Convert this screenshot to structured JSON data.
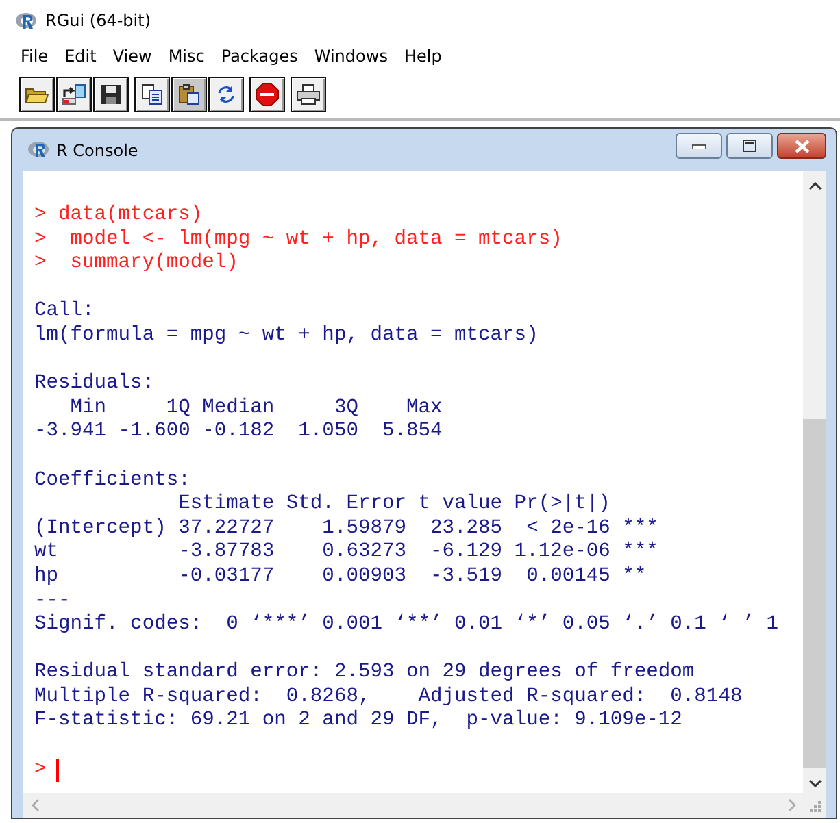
{
  "window": {
    "title": "RGui (64-bit)"
  },
  "menu": [
    "File",
    "Edit",
    "View",
    "Misc",
    "Packages",
    "Windows",
    "Help"
  ],
  "console": {
    "title": "R Console",
    "blocks": [
      {
        "lines": [
          {
            "kind": "input",
            "text": "> data(mtcars)"
          },
          {
            "kind": "input",
            "text": ">  model <- lm(mpg ~ wt + hp, data = mtcars)"
          },
          {
            "kind": "input",
            "text": ">  summary(model)"
          }
        ]
      },
      {
        "lines": [
          {
            "kind": "output",
            "text": "Call:"
          },
          {
            "kind": "output",
            "text": "lm(formula = mpg ~ wt + hp, data = mtcars)"
          }
        ]
      },
      {
        "lines": [
          {
            "kind": "output",
            "text": "Residuals:"
          },
          {
            "kind": "output",
            "text": "   Min     1Q Median     3Q    Max"
          },
          {
            "kind": "output",
            "text": "-3.941 -1.600 -0.182  1.050  5.854"
          }
        ]
      },
      {
        "lines": [
          {
            "kind": "output",
            "text": "Coefficients:"
          },
          {
            "kind": "output",
            "text": "            Estimate Std. Error t value Pr(>|t|)"
          },
          {
            "kind": "output",
            "text": "(Intercept) 37.22727    1.59879  23.285  < 2e-16 ***"
          },
          {
            "kind": "output",
            "text": "wt          -3.87783    0.63273  -6.129 1.12e-06 ***"
          },
          {
            "kind": "output",
            "text": "hp          -0.03177    0.00903  -3.519  0.00145 **"
          },
          {
            "kind": "output",
            "text": "---"
          },
          {
            "kind": "output",
            "text": "Signif. codes:  0 ‘***’ 0.001 ‘**’ 0.01 ‘*’ 0.05 ‘.’ 0.1 ‘ ’ 1"
          }
        ]
      },
      {
        "lines": [
          {
            "kind": "output",
            "text": "Residual standard error: 2.593 on 29 degrees of freedom"
          },
          {
            "kind": "output",
            "text": "Multiple R-squared:  0.8268,    Adjusted R-squared:  0.8148"
          },
          {
            "kind": "output",
            "text": "F-statistic: 69.21 on 2 and 29 DF,  p-value: 9.109e-12"
          }
        ]
      }
    ],
    "prompt": ">"
  }
}
